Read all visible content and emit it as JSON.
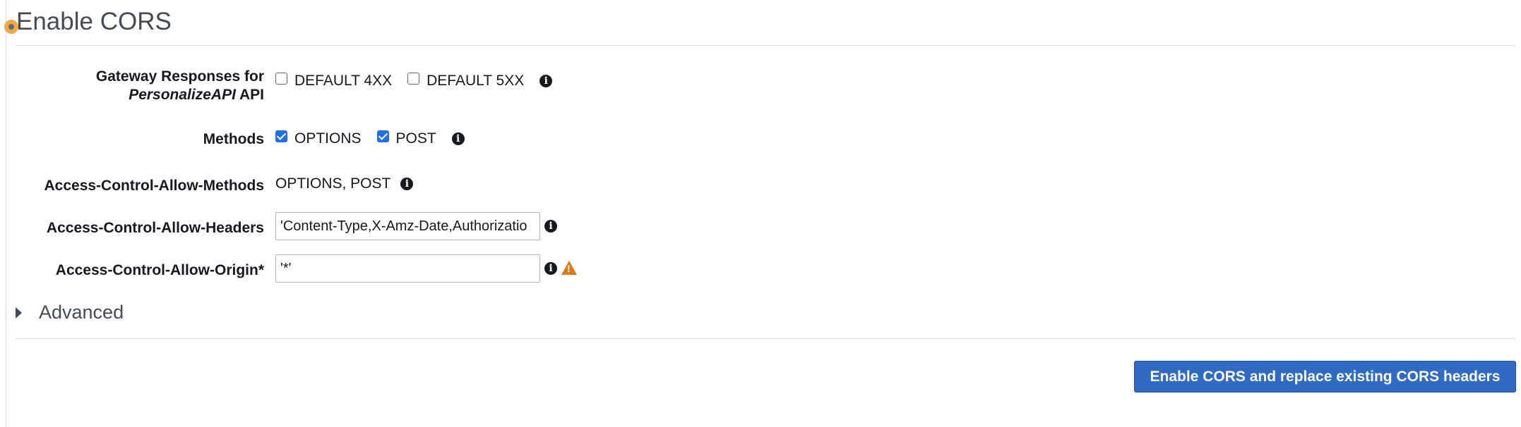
{
  "section": {
    "title": "Enable CORS",
    "advanced_label": "Advanced"
  },
  "gateway_responses": {
    "label_prefix": "Gateway Responses for",
    "api_name": "PersonalizeAPI",
    "label_suffix": "API",
    "options": [
      {
        "label": "DEFAULT 4XX",
        "checked": false
      },
      {
        "label": "DEFAULT 5XX",
        "checked": false
      }
    ]
  },
  "methods": {
    "label": "Methods",
    "options": [
      {
        "label": "OPTIONS",
        "checked": true
      },
      {
        "label": "POST",
        "checked": true
      }
    ]
  },
  "allow_methods": {
    "label": "Access-Control-Allow-Methods",
    "value": "OPTIONS, POST"
  },
  "allow_headers": {
    "label": "Access-Control-Allow-Headers",
    "value": "'Content-Type,X-Amz-Date,Authorizatio"
  },
  "allow_origin": {
    "label": "Access-Control-Allow-Origin*",
    "value": "'*'"
  },
  "actions": {
    "primary_label": "Enable CORS and replace existing CORS headers"
  },
  "colors": {
    "primary": "#2f6bc2",
    "warning": "#d97a1b",
    "checkbox_checked": "#1e6ff0"
  }
}
